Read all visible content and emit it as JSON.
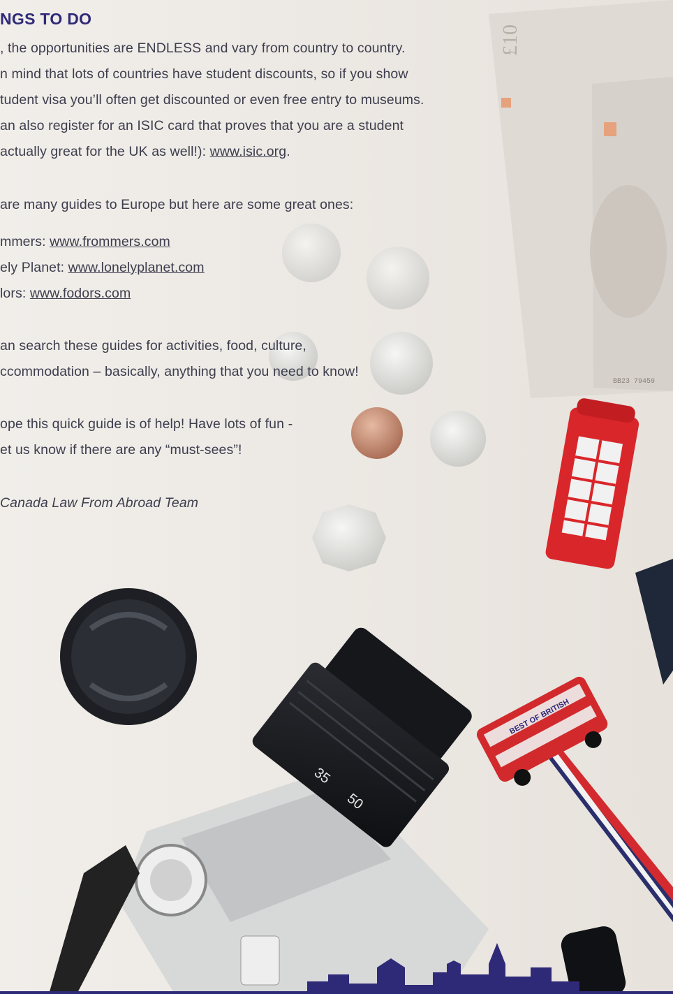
{
  "heading": "NGS TO DO",
  "paragraph1": {
    "line1": ", the opportunities are ENDLESS and vary from country to country.",
    "line2": "n mind that lots of countries have student discounts, so if you show",
    "line3": "tudent visa you’ll often get discounted or even free entry to museums.",
    "line4": "an also register for an ISIC card that proves that you are a student",
    "line5_text": " actually great for the UK as well!): ",
    "line5_link": "www.isic.org",
    "line5_end": "."
  },
  "paragraph2": "are many guides to Europe but here are some great ones:",
  "guides": [
    {
      "label": "mmers: ",
      "url": "www.frommers.com"
    },
    {
      "label": "ely Planet: ",
      "url": "www.lonelyplanet.com"
    },
    {
      "label": "lors: ",
      "url": "www.fodors.com"
    }
  ],
  "paragraph3": {
    "line1": "an search these guides for activities, food, culture,",
    "line2": "ccommodation – basically, anything that you need to know!"
  },
  "paragraph4": {
    "line1": "ope this quick guide is of help! Have lots of fun -",
    "line2": "et us know if there are any “must-sees”!"
  },
  "signature": "Canada Law From Abroad Team",
  "banknote_denomination": "£10",
  "banknote_serial": "BB23 79459",
  "bus_sign": "BEST OF BRITISH",
  "lens_markings": [
    "35",
    "50"
  ],
  "colors": {
    "heading": "#2f2a78",
    "body_text": "#3d3d4d",
    "background": "#ece8e3"
  }
}
